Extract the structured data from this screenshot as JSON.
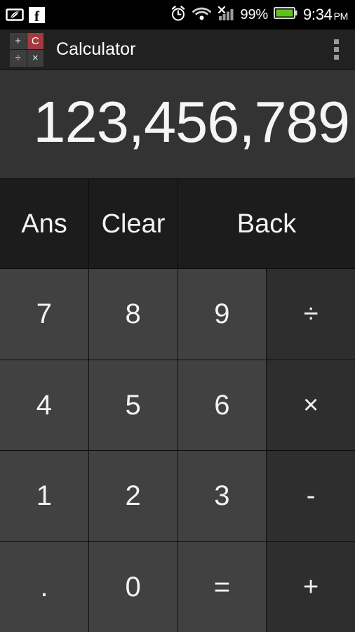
{
  "status_bar": {
    "notification_icons": [
      "evernote-notification-icon",
      "facebook-notification-icon"
    ],
    "facebook_glyph": "f",
    "alarm_icon": "alarm-clock-icon",
    "wifi_icon": "wifi-icon",
    "signal_icon": "cell-signal-no-service-icon",
    "battery_percent": "99%",
    "battery_icon": "battery-full-icon",
    "time": "9:34",
    "am_pm": "PM"
  },
  "action_bar": {
    "title": "Calculator",
    "app_icon": {
      "top_left": "+",
      "top_right": "C",
      "bottom_left": "÷",
      "bottom_right": "×",
      "accent_color": "#a43a3f"
    },
    "overflow_menu": "overflow-menu-icon"
  },
  "display": {
    "value": "123,456,789"
  },
  "keypad": {
    "function_row": [
      {
        "label": "Ans",
        "name": "ans-key"
      },
      {
        "label": "Clear",
        "name": "clear-key"
      },
      {
        "label": "Back",
        "name": "back-key"
      }
    ],
    "rows": [
      [
        {
          "label": "7",
          "name": "key-7"
        },
        {
          "label": "8",
          "name": "key-8"
        },
        {
          "label": "9",
          "name": "key-9"
        },
        {
          "label": "÷",
          "name": "key-divide"
        }
      ],
      [
        {
          "label": "4",
          "name": "key-4"
        },
        {
          "label": "5",
          "name": "key-5"
        },
        {
          "label": "6",
          "name": "key-6"
        },
        {
          "label": "×",
          "name": "key-multiply"
        }
      ],
      [
        {
          "label": "1",
          "name": "key-1"
        },
        {
          "label": "2",
          "name": "key-2"
        },
        {
          "label": "3",
          "name": "key-3"
        },
        {
          "label": "-",
          "name": "key-minus"
        }
      ],
      [
        {
          "label": ".",
          "name": "key-decimal"
        },
        {
          "label": "0",
          "name": "key-0"
        },
        {
          "label": "=",
          "name": "key-equals"
        },
        {
          "label": "+",
          "name": "key-plus"
        }
      ]
    ]
  },
  "colors": {
    "status_bar_bg": "#000000",
    "action_bar_bg": "#212121",
    "display_bg": "#333333",
    "number_key_bg": "#414141",
    "operator_key_bg": "#2e2e2e",
    "function_key_bg": "#1c1c1c",
    "battery_green": "#5ec11e",
    "text": "#f2f2f2"
  }
}
